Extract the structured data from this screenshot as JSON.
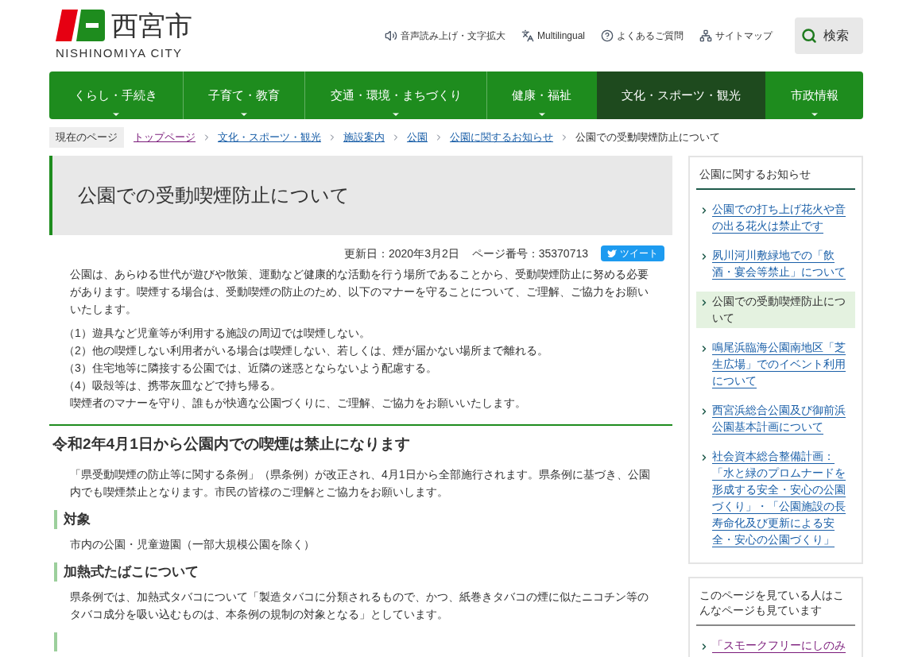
{
  "header": {
    "logo_name": "西宮市",
    "logo_roman": "NISHINOMIYA CITY",
    "utility_links": [
      {
        "label": "音声読み上げ・文字拡大",
        "kind": "speaker"
      },
      {
        "label": "Multilingual",
        "kind": "translate"
      },
      {
        "label": "よくあるご質問",
        "kind": "help"
      },
      {
        "label": "サイトマップ",
        "kind": "sitemap"
      }
    ],
    "search_button": "検索"
  },
  "nav": [
    {
      "label": "くらし・手続き",
      "selected": false
    },
    {
      "label": "子育て・教育",
      "selected": false
    },
    {
      "label": "交通・環境・まちづくり",
      "selected": false
    },
    {
      "label": "健康・福祉",
      "selected": false
    },
    {
      "label": "文化・スポーツ・観光",
      "selected": true
    },
    {
      "label": "市政情報",
      "selected": false
    }
  ],
  "breadcrumb": {
    "label": "現在のページ",
    "items": [
      {
        "label": "トップページ",
        "kind": "link",
        "visited": true
      },
      {
        "label": "文化・スポーツ・観光",
        "kind": "link",
        "visited": false
      },
      {
        "label": "施設案内",
        "kind": "link",
        "visited": false
      },
      {
        "label": "公園",
        "kind": "link",
        "visited": false
      },
      {
        "label": "公園に関するお知らせ",
        "kind": "link",
        "visited": false
      },
      {
        "label": "公園での受動喫煙防止について",
        "kind": "current"
      }
    ]
  },
  "article": {
    "title": "公園での受動喫煙防止について",
    "updated": "更新日：2020年3月2日",
    "page_number": "ページ番号：35370713",
    "tweet_button": "ツイート",
    "intro": "公園は、あらゆる世代が遊びや散策、運動など健康的な活動を行う場所であることから、受動喫煙防止に努める必要があります。喫煙する場合は、受動喫煙の防止のため、以下のマナーを守ることについて、ご理解、ご協力をお願いいたします。",
    "rules": [
      "（1）遊具など児童等が利用する施設の周辺では喫煙しない。",
      "（2）他の喫煙しない利用者がいる場合は喫煙しない、若しくは、煙が届かない場所まで離れる。",
      "（3）住宅地等に隣接する公園では、近隣の迷惑とならないよう配慮する。",
      "（4）吸殻等は、携帯灰皿などで持ち帰る。"
    ],
    "closing": "喫煙者のマナーを守り、誰もが快適な公園づくりに、ご理解、ご協力をお願いいたします。",
    "section": {
      "heading": "令和2年4月1日から公園内での喫煙は禁止になります",
      "text": "「県受動喫煙の防止等に関する条例」（県条例）が改正され、4月1日から全部施行されます。県条例に基づき、公園内でも喫煙禁止となります。市民の皆様のご理解とご協力をお願いします。",
      "subsections": [
        {
          "heading": "対象",
          "text": "市内の公園・児童遊園（一部大規模公園を除く）"
        },
        {
          "heading": "加熱式たばこについて",
          "text": "県条例では、加熱式タバコについて「製造タバコに分類されるもので、かつ、紙巻きタバコの煙に似たニコチン等のタバコ成分を吸い込むものは、本条例の規制の対象となる」としています。"
        }
      ]
    }
  },
  "sidebar": [
    {
      "title": "公園に関するお知らせ",
      "links": [
        {
          "label": "公園での打ち上げ花火や音の出る花火は禁止です",
          "selected": false,
          "visited": false
        },
        {
          "label": "夙川河川敷緑地での「飲酒・宴会等禁止」について",
          "selected": false,
          "visited": false
        },
        {
          "label": "公園での受動喫煙防止について",
          "selected": true,
          "visited": false
        },
        {
          "label": "鳴尾浜臨海公園南地区「芝生広場」でのイベント利用について",
          "selected": false,
          "visited": false
        },
        {
          "label": "西宮浜総合公園及び御前浜公園基本計画について",
          "selected": false,
          "visited": false
        },
        {
          "label": "社会資本総合整備計画：「水と緑のプロムナードを形成する安全・安心の公園づくり」・「公園施設の長寿命化及び更新による安全・安心の公園づくり」",
          "selected": false,
          "visited": false
        }
      ]
    },
    {
      "title": "このページを見ている人はこんなページも見ています",
      "links": [
        {
          "label": "「スモークフリーにしのみ",
          "selected": false,
          "visited": true
        }
      ]
    }
  ]
}
